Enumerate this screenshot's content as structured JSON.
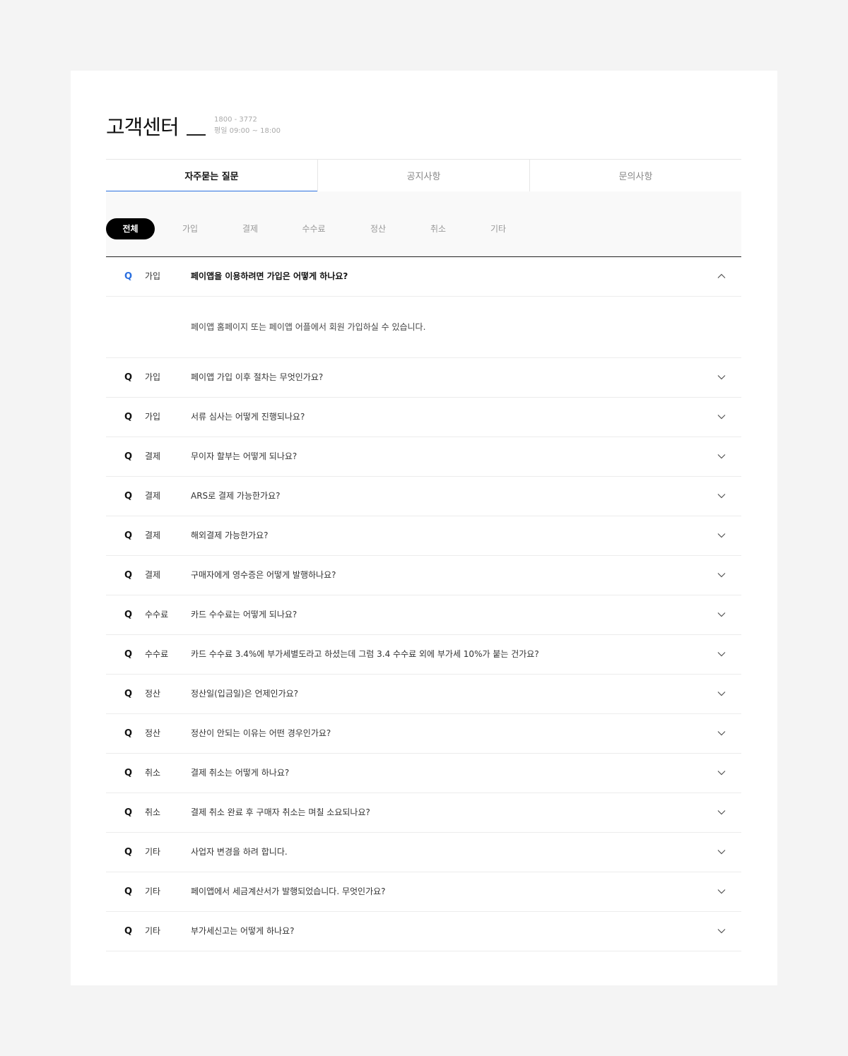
{
  "header": {
    "title": "고객센터",
    "phone": "1800 - 3772",
    "hours": "평일 09:00 ~ 18:00"
  },
  "tabs": [
    {
      "label": "자주묻는 질문",
      "active": true
    },
    {
      "label": "공지사항",
      "active": false
    },
    {
      "label": "문의사항",
      "active": false
    }
  ],
  "filters": [
    {
      "label": "전체",
      "active": true
    },
    {
      "label": "가입",
      "active": false
    },
    {
      "label": "결제",
      "active": false
    },
    {
      "label": "수수료",
      "active": false
    },
    {
      "label": "정산",
      "active": false
    },
    {
      "label": "취소",
      "active": false
    },
    {
      "label": "기타",
      "active": false
    }
  ],
  "faq": {
    "q_marker": "Q",
    "expanded": {
      "category": "가입",
      "question": "페이앱을 이용하려면 가입은 어떻게 하나요?",
      "answer": "페이앱 홈페이지 또는 페이앱 어플에서 회원 가입하실 수 있습니다."
    },
    "items": [
      {
        "category": "가입",
        "question": "페이앱 가입 이후 절차는 무엇인가요?"
      },
      {
        "category": "가입",
        "question": "서류 심사는 어떻게 진행되나요?"
      },
      {
        "category": "결제",
        "question": "무이자 할부는 어떻게 되나요?"
      },
      {
        "category": "결제",
        "question": "ARS로 결제 가능한가요?"
      },
      {
        "category": "결제",
        "question": "해외결제 가능한가요?"
      },
      {
        "category": "결제",
        "question": "구매자에게 영수증은 어떻게 발행하나요?"
      },
      {
        "category": "수수료",
        "question": "카드 수수료는 어떻게 되나요?"
      },
      {
        "category": "수수료",
        "question": "카드 수수료 3.4%에 부가세별도라고 하셨는데 그럼 3.4 수수료 외에 부가세 10%가 붙는 건가요?"
      },
      {
        "category": "정산",
        "question": "정산일(입금일)은 언제인가요?"
      },
      {
        "category": "정산",
        "question": "정산이 안되는 이유는 어떤 경우인가요?"
      },
      {
        "category": "취소",
        "question": "결제 취소는 어떻게 하나요?"
      },
      {
        "category": "취소",
        "question": "결제 취소 완료 후 구매자 취소는 며칠 소요되나요?"
      },
      {
        "category": "기타",
        "question": "사업자 변경을 하려 합니다."
      },
      {
        "category": "기타",
        "question": "페이앱에서 세금계산서가 발행되었습니다. 무엇인가요?"
      },
      {
        "category": "기타",
        "question": "부가세신고는 어떻게 하나요?"
      }
    ]
  },
  "colors": {
    "accent": "#2a6fe0",
    "chip_active": "#000000",
    "background": "#f4f4f4"
  },
  "icons": {
    "collapse": "chevron-up-icon",
    "expand": "chevron-down-icon"
  }
}
